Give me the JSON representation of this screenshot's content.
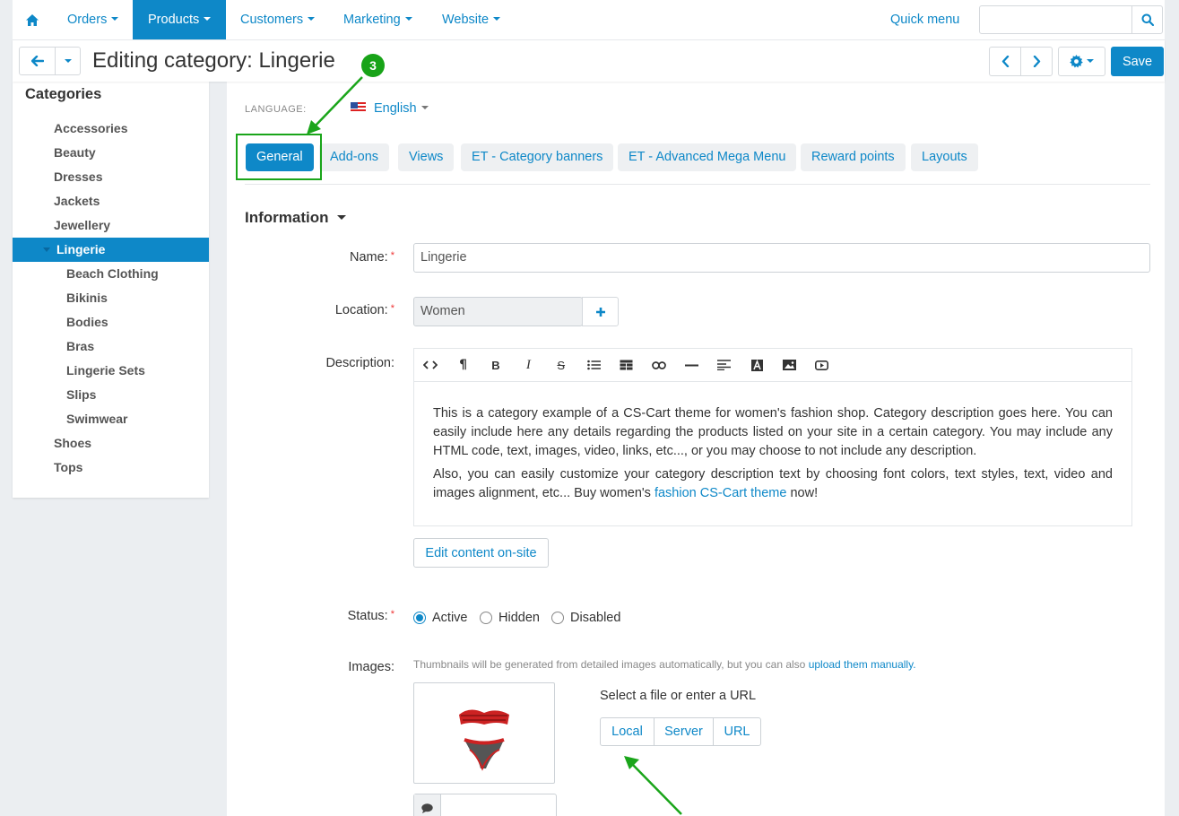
{
  "nav": {
    "items": [
      "Orders",
      "Products",
      "Customers",
      "Marketing",
      "Website"
    ],
    "active": "Products",
    "quick_menu": "Quick menu",
    "search_placeholder": ""
  },
  "titlebar": {
    "title": "Editing category: Lingerie",
    "save_label": "Save"
  },
  "sidebar": {
    "title": "Categories",
    "items": [
      {
        "label": "Accessories"
      },
      {
        "label": "Beauty"
      },
      {
        "label": "Dresses"
      },
      {
        "label": "Jackets"
      },
      {
        "label": "Jewellery"
      },
      {
        "label": "Lingerie",
        "active": true
      },
      {
        "label": "Beach Clothing"
      },
      {
        "label": "Bikinis"
      },
      {
        "label": "Bodies"
      },
      {
        "label": "Bras"
      },
      {
        "label": "Lingerie Sets"
      },
      {
        "label": "Slips"
      },
      {
        "label": "Swimwear"
      },
      {
        "label": "Shoes"
      },
      {
        "label": "Tops"
      }
    ]
  },
  "main": {
    "language_label": "LANGUAGE:",
    "language_value": "English",
    "tabs": [
      "General",
      "Add-ons",
      "Views",
      "ET - Category banners",
      "ET - Advanced Mega Menu",
      "Reward points",
      "Layouts"
    ],
    "section_title": "Information",
    "name_label": "Name:",
    "name_value": "Lingerie",
    "location_label": "Location:",
    "location_value": "Women",
    "description_label": "Description:",
    "description_p1": "This is a category example of a CS-Cart theme for women's fashion shop. Category description goes here. You can easily include here any details regarding the products listed on your site in a certain category. You may include any HTML code, text, images, video, links, etc..., or you may choose to not include any description.",
    "description_p2_pre": "Also, you can easily customize your category description text by choosing font colors, text styles, text, video and images alignment, etc... Buy women's ",
    "description_p2_link": "fashion CS-Cart theme",
    "description_p2_post": " now!",
    "edit_onsite_label": "Edit content on-site",
    "status_label": "Status:",
    "status_options": [
      "Active",
      "Hidden",
      "Disabled"
    ],
    "status_selected": "Active",
    "images_label": "Images:",
    "images_hint_pre": "Thumbnails will be generated from detailed images automatically, but you can also ",
    "images_hint_link": "upload them manually.",
    "file_prompt": "Select a file or enter a URL",
    "file_sources": [
      "Local",
      "Server",
      "URL"
    ]
  },
  "annotation": {
    "step_number": "3",
    "color": "#18a318"
  },
  "colors": {
    "accent": "#0e88c8",
    "background": "#ebeef1",
    "required": "#e33333"
  }
}
